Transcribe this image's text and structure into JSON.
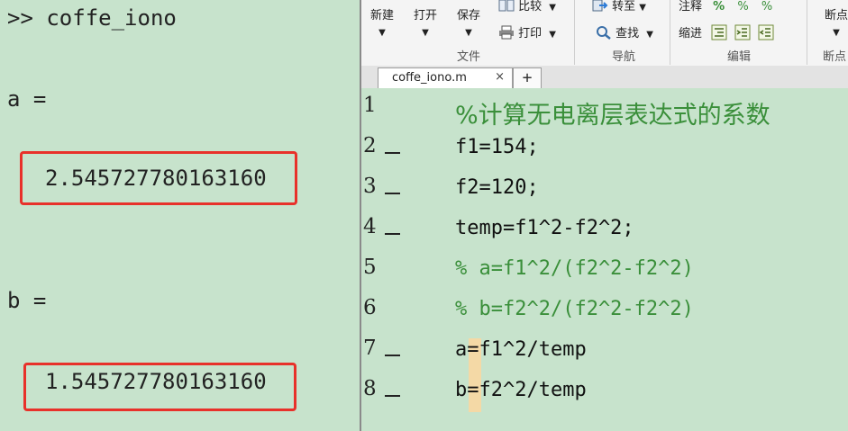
{
  "command_window": {
    "prompt_line": ">> coffe_iono",
    "a_label": "a =",
    "a_value": "2.545727780163160",
    "b_label": "b =",
    "b_value": "1.545727780163160"
  },
  "toolbar": {
    "new_label": "新建",
    "open_label": "打开",
    "save_label": "保存",
    "compare_label": "比较",
    "print_label": "打印",
    "goto_label": "转至",
    "find_label": "查找",
    "comment_label": "注释",
    "indent_label": "缩进",
    "breakpoints_label": "断点",
    "section_file": "文件",
    "section_navigate": "导航",
    "section_edit": "编辑",
    "section_breakpoints": "断点"
  },
  "tabs": {
    "active_tab": "coffe_iono.m",
    "close_glyph": "×",
    "add_glyph": "+"
  },
  "editor": {
    "lines": [
      {
        "num": "1",
        "text": "%计算无电离层表达式的系数",
        "comment": true,
        "executable": false
      },
      {
        "num": "2",
        "text": "f1=154;",
        "comment": false,
        "executable": true
      },
      {
        "num": "3",
        "text": "f2=120;",
        "comment": false,
        "executable": true
      },
      {
        "num": "4",
        "text": "temp=f1^2-f2^2;",
        "comment": false,
        "executable": true
      },
      {
        "num": "5",
        "text": "% a=f1^2/(f2^2-f2^2)",
        "comment": true,
        "executable": false
      },
      {
        "num": "6",
        "text": "% b=f2^2/(f2^2-f2^2)",
        "comment": true,
        "executable": false
      },
      {
        "num": "7",
        "text": "a=f1^2/temp",
        "comment": false,
        "executable": true
      },
      {
        "num": "8",
        "text": "b=f2^2/temp",
        "comment": false,
        "executable": true
      }
    ]
  },
  "colors": {
    "background": "#c7e3cc",
    "highlight_box": "#e8312a",
    "comment": "#3a8f3a"
  }
}
